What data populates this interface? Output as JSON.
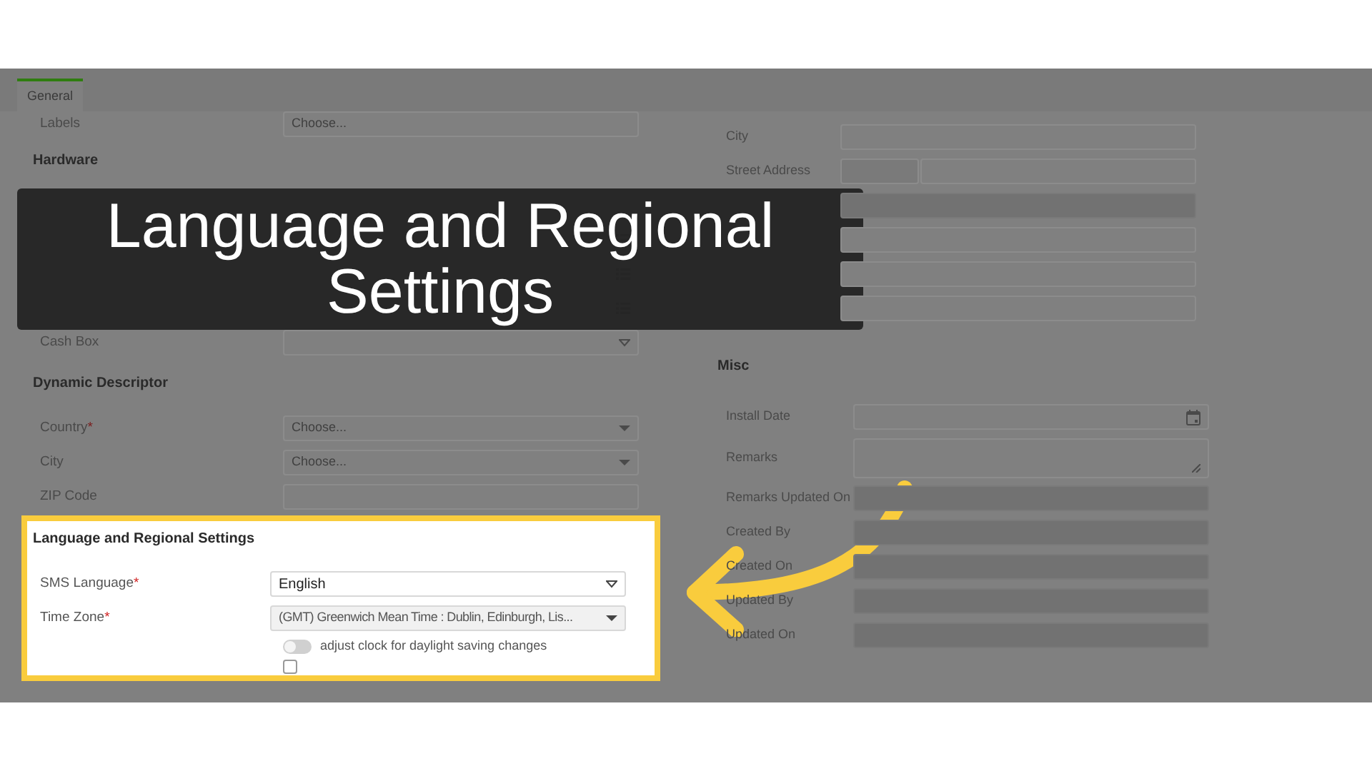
{
  "tabs": [
    {
      "label": "General",
      "selected": true
    }
  ],
  "left_column": {
    "fields": [
      {
        "label": "Labels",
        "kind": "select_plain",
        "placeholder": "Choose..."
      }
    ],
    "sections": [
      {
        "heading": "Hardware",
        "fields": [
          {
            "kind": "input"
          },
          {
            "kind": "list"
          },
          {
            "kind": "list"
          },
          {
            "kind": "list"
          },
          {
            "label": "Cash Box",
            "kind": "select_outline"
          }
        ]
      },
      {
        "heading": "Dynamic Descriptor",
        "fields": [
          {
            "label": "Country",
            "required_mark": "*",
            "kind": "select",
            "placeholder": "Choose..."
          },
          {
            "label": "City",
            "kind": "select",
            "placeholder": "Choose..."
          },
          {
            "label": "ZIP Code",
            "kind": "input"
          }
        ]
      }
    ]
  },
  "highlight_section": {
    "heading": "Language and Regional Settings",
    "fields": [
      {
        "label": "SMS Language",
        "required_mark": "*",
        "kind": "select_outline",
        "value": "English"
      },
      {
        "label": "Time Zone",
        "required_mark": "*",
        "kind": "select",
        "disabled": true,
        "value": "(GMT) Greenwich Mean Time : Dublin, Edinburgh, Lis..."
      }
    ],
    "toggle": {
      "label": "adjust clock for daylight saving changes",
      "on": false
    },
    "checkbox": {
      "checked": false
    }
  },
  "right_column": {
    "fields": [
      {
        "label": "City",
        "kind": "input"
      },
      {
        "label": "Street Address",
        "kind": "split"
      },
      {
        "kind": "input",
        "disabled": true
      },
      {
        "kind": "input"
      },
      {
        "kind": "input"
      },
      {
        "kind": "input"
      }
    ],
    "sections": [
      {
        "heading": "Misc",
        "fields": [
          {
            "label": "Install Date",
            "kind": "date"
          },
          {
            "label": "Remarks",
            "kind": "textarea"
          },
          {
            "label": "Remarks Updated On",
            "kind": "input",
            "disabled": true
          },
          {
            "label": "Created By",
            "kind": "input",
            "disabled": true
          },
          {
            "label": "Created On",
            "kind": "input",
            "disabled": true
          },
          {
            "label": "Updated By",
            "kind": "input",
            "disabled": true
          },
          {
            "label": "Updated On",
            "kind": "input",
            "disabled": true
          }
        ]
      }
    ]
  },
  "banner": {
    "title": "Language and Regional Settings"
  }
}
